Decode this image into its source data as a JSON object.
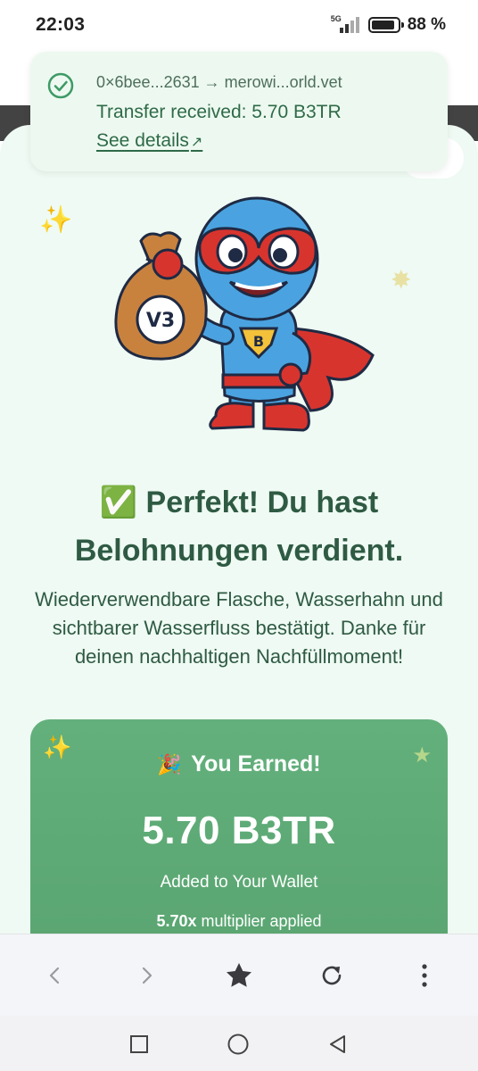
{
  "status_bar": {
    "time": "22:03",
    "network": "5G",
    "battery_percent": "88 %",
    "battery_level": 0.88
  },
  "notification": {
    "route_text": "0×6bee...2631 → merowi...orld.vet",
    "title": "Transfer received: 5.70 B3TR",
    "link_label": "See details",
    "link_icon": "arrow-up-right-icon"
  },
  "hero": {
    "title": "✅ Perfekt! Du hast Belohnungen verdient.",
    "subtitle": "Wiederverwendbare Flasche, Wasserhahn und sichtbarer Wasserfluss bestätigt. Danke für deinen nachhaltigen Nachfüllmoment!",
    "mascot_bag_text": "V3",
    "mascot_badge_text": "B"
  },
  "earned": {
    "emoji": "🎉",
    "title": "You Earned!",
    "amount": "5.70 B3TR",
    "subtitle": "Added to Your Wallet",
    "multiplier_value": "5.70x",
    "multiplier_text": " multiplier applied"
  },
  "browser_bar": {
    "icons": [
      "back-arrow-icon",
      "forward-arrow-icon",
      "star-icon",
      "reload-icon",
      "more-vert-icon"
    ]
  },
  "nav_bar": {
    "icons": [
      "recents-square-icon",
      "home-circle-icon",
      "back-triangle-icon"
    ]
  },
  "colors": {
    "page_bg": "#eefaf3",
    "text_green": "#2f5a43",
    "earn_card": "#5fab77",
    "notif_bg": "#edf9f0"
  }
}
